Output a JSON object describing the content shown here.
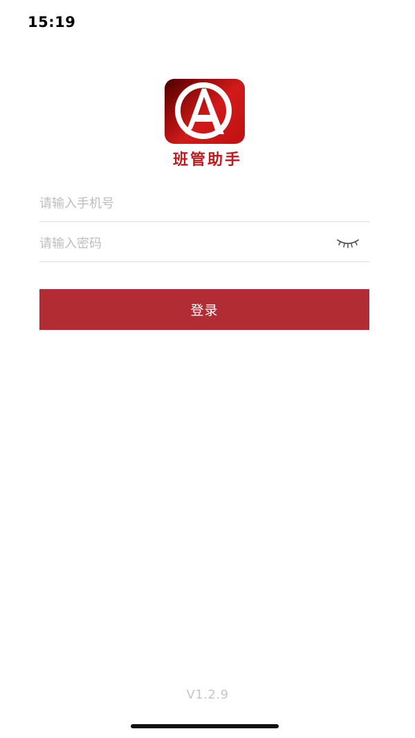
{
  "status_bar": {
    "time": "15:19"
  },
  "logo": {
    "icon": "letter-a-circle-logo",
    "app_name": "班管助手",
    "colors": {
      "dark": "#4a0000",
      "bright": "#d11a1a"
    }
  },
  "form": {
    "phone_placeholder": "请输入手机号",
    "phone_value": "",
    "password_placeholder": "请输入密码",
    "password_value": "",
    "eye_icon": "eye-closed-icon"
  },
  "login_button": {
    "label": "登录",
    "color": "#b22c34"
  },
  "footer": {
    "version": "V1.2.9"
  }
}
